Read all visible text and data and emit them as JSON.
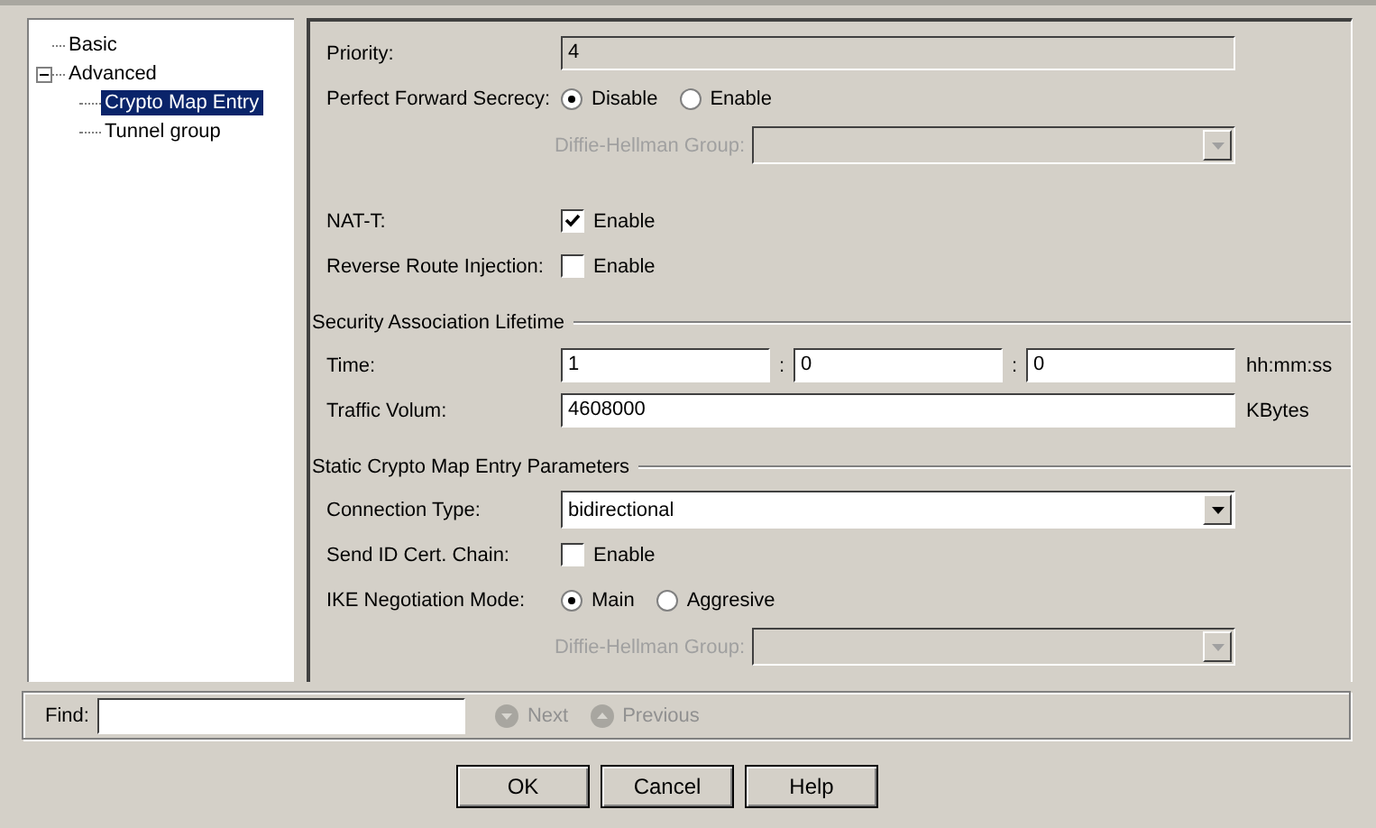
{
  "tree": [
    {
      "label": "Basic",
      "selected": false
    },
    {
      "label": "Advanced",
      "selected": false,
      "expanded": true,
      "children": [
        {
          "label": "Crypto Map Entry",
          "selected": true
        },
        {
          "label": "Tunnel group",
          "selected": false
        }
      ]
    }
  ],
  "rows": [
    {
      "kind": "field",
      "label": "Priority:",
      "value": "4",
      "disabled": true
    },
    {
      "kind": "radio",
      "label": "Perfect Forward Secrecy:",
      "options": [
        {
          "label": "Disable",
          "selected": true
        },
        {
          "label": "Enable",
          "selected": false
        }
      ]
    },
    {
      "kind": "subdropdown",
      "label": "Diffie-Hellman Group:",
      "disabled": true
    },
    {
      "kind": "checkbox",
      "label": "NAT-T:",
      "option": "Enable",
      "checked": true
    },
    {
      "kind": "checkbox",
      "label": "Reverse Route Injection:",
      "option": "Enable",
      "checked": false
    },
    {
      "kind": "section",
      "label": "Security Association Lifetime"
    },
    {
      "kind": "time",
      "label": "Time:",
      "parts": [
        {
          "value": "1"
        },
        {
          "separator": ":",
          "value": "0"
        },
        {
          "separator": ":",
          "value": "0"
        }
      ],
      "unit": "hh:mm:ss"
    },
    {
      "kind": "field",
      "label": "Traffic Volum:",
      "value": "4608000",
      "disabled": false,
      "unit": "KBytes"
    },
    {
      "kind": "section",
      "label": "Static Crypto Map Entry Parameters"
    },
    {
      "kind": "dropdown",
      "label": "Connection Type:",
      "value": "bidirectional",
      "disabled": false
    },
    {
      "kind": "checkbox",
      "label": "Send ID Cert. Chain:",
      "option": "Enable",
      "checked": false
    },
    {
      "kind": "radio",
      "label": "IKE Negotiation Mode:",
      "options": [
        {
          "label": "Main",
          "selected": true
        },
        {
          "label": "Aggresive",
          "selected": false
        }
      ]
    },
    {
      "kind": "subdropdown",
      "label": "Diffie-Hellman Group:",
      "disabled": true
    }
  ],
  "find": {
    "label": "Find:",
    "buttons": [
      {
        "label": "Next",
        "kind": "down",
        "disabled": true
      },
      {
        "label": "Previous",
        "kind": "up",
        "disabled": true
      }
    ]
  },
  "buttons": [
    "OK",
    "Cancel",
    "Help"
  ]
}
